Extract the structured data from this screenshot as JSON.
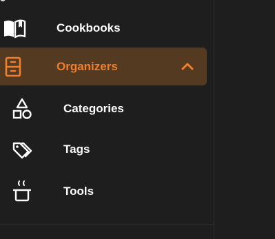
{
  "sidebar": {
    "items": [
      {
        "label": "Cookbooks",
        "icon": "open-book-icon"
      },
      {
        "label": "Organizers",
        "icon": "filing-cabinet-icon",
        "active": true,
        "expanded": true
      },
      {
        "label": "Categories",
        "icon": "shapes-icon"
      },
      {
        "label": "Tags",
        "icon": "tags-icon"
      },
      {
        "label": "Tools",
        "icon": "pot-icon"
      }
    ]
  },
  "colors": {
    "background": "#1e1e1e",
    "active_background": "#553a22",
    "accent": "#f07f2b",
    "text": "#ffffff"
  }
}
